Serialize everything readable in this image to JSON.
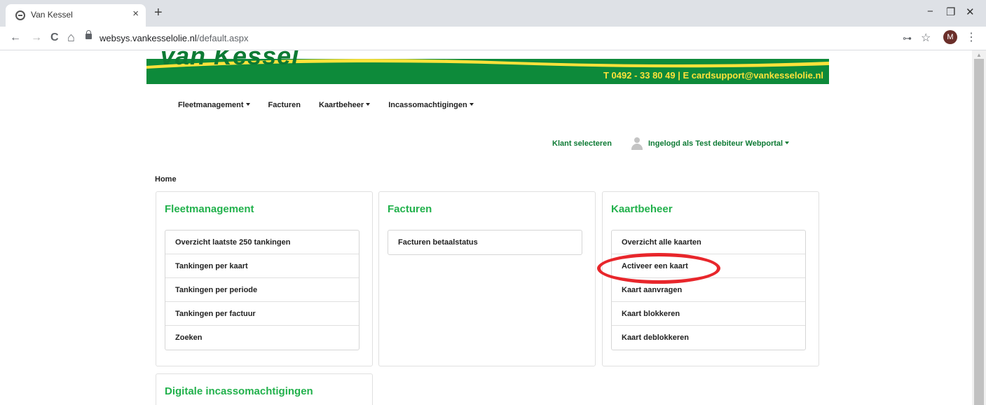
{
  "browser": {
    "tab_title": "Van Kessel",
    "tab_close": "×",
    "new_tab": "+",
    "url_domain": "websys.vankesselolie.nl",
    "url_path": "/default.aspx",
    "profile_initial": "M",
    "controls": {
      "minimize": "−",
      "restore": "❐",
      "close": "✕"
    },
    "nav": {
      "back": "←",
      "forward": "→",
      "reload": "C",
      "home": "⌂"
    },
    "icons": {
      "key": "⊶",
      "star": "☆",
      "menu": "⋮"
    }
  },
  "site": {
    "logo_text": "van Kessel",
    "contact": "T  0492 - 33 80 49   |   E  cardsupport@vankesselolie.nl",
    "brand_color": "#0d8a3a",
    "accent_color": "#ffe23a",
    "title_color": "#22b14c"
  },
  "nav": {
    "items": [
      {
        "label": "Fleetmanagement",
        "dropdown": true
      },
      {
        "label": "Facturen",
        "dropdown": false
      },
      {
        "label": "Kaartbeheer",
        "dropdown": true
      },
      {
        "label": "Incassomachtigingen",
        "dropdown": true
      }
    ]
  },
  "user": {
    "select_client": "Klant selecteren",
    "logged_in_as": "Ingelogd als Test debiteur Webportal"
  },
  "breadcrumb": "Home",
  "panels": [
    {
      "title": "Fleetmanagement",
      "items": [
        "Overzicht laatste 250 tankingen",
        "Tankingen per kaart",
        "Tankingen per periode",
        "Tankingen per factuur",
        "Zoeken"
      ]
    },
    {
      "title": "Facturen",
      "items": [
        "Facturen betaalstatus"
      ]
    },
    {
      "title": "Kaartbeheer",
      "items": [
        "Overzicht alle kaarten",
        "Activeer een kaart",
        "Kaart aanvragen",
        "Kaart blokkeren",
        "Kaart deblokkeren"
      ]
    },
    {
      "title": "Digitale incassomachtigingen",
      "items": []
    }
  ],
  "annotation": {
    "highlighted_item": "Activeer een kaart",
    "color": "#e8262b"
  }
}
